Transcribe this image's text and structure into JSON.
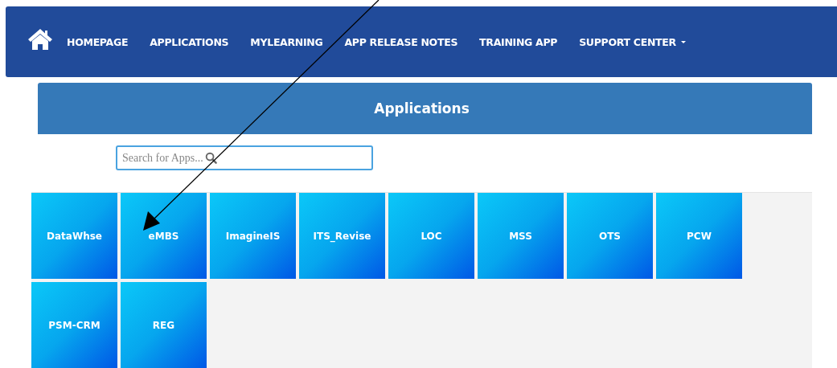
{
  "nav": {
    "items": [
      {
        "label": "HOMEPAGE",
        "dropdown": false
      },
      {
        "label": "APPLICATIONS",
        "dropdown": false
      },
      {
        "label": "MYLEARNING",
        "dropdown": false
      },
      {
        "label": "APP RELEASE NOTES",
        "dropdown": false
      },
      {
        "label": "TRAINING APP",
        "dropdown": false
      },
      {
        "label": "SUPPORT CENTER",
        "dropdown": true
      }
    ]
  },
  "header": {
    "title": "Applications"
  },
  "search": {
    "placeholder": "Search for Apps..."
  },
  "apps": [
    {
      "label": "DataWhse"
    },
    {
      "label": "eMBS"
    },
    {
      "label": "ImagineIS"
    },
    {
      "label": "ITS_Revise"
    },
    {
      "label": "LOC"
    },
    {
      "label": "MSS"
    },
    {
      "label": "OTS"
    },
    {
      "label": "PCW"
    },
    {
      "label": "PSM-CRM"
    },
    {
      "label": "REG"
    }
  ]
}
